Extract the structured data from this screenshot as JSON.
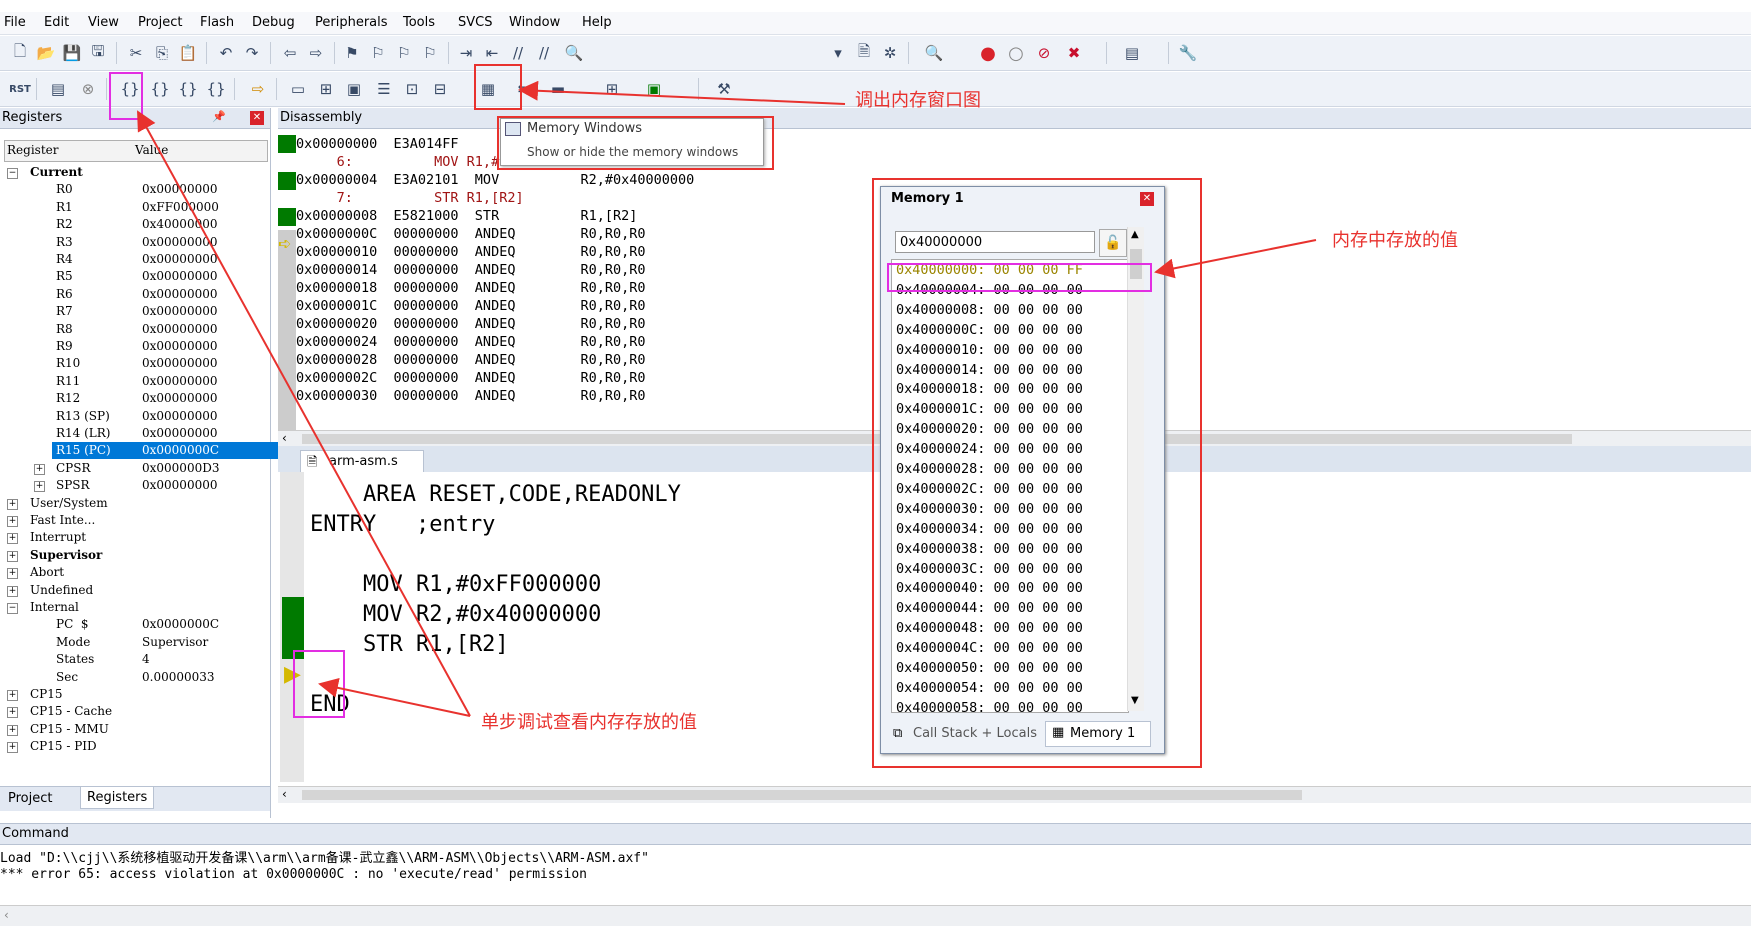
{
  "menu": [
    "File",
    "Edit",
    "View",
    "Project",
    "Flash",
    "Debug",
    "Peripherals",
    "Tools",
    "SVCS",
    "Window",
    "Help"
  ],
  "registers": {
    "title": "Registers",
    "columns": [
      "Register",
      "Value"
    ],
    "rows": [
      {
        "name": "Current",
        "value": "",
        "indent": 0,
        "expand": "−",
        "bold": true
      },
      {
        "name": "R0",
        "value": "0x00000000",
        "indent": 2
      },
      {
        "name": "R1",
        "value": "0xFF000000",
        "indent": 2
      },
      {
        "name": "R2",
        "value": "0x40000000",
        "indent": 2
      },
      {
        "name": "R3",
        "value": "0x00000000",
        "indent": 2
      },
      {
        "name": "R4",
        "value": "0x00000000",
        "indent": 2
      },
      {
        "name": "R5",
        "value": "0x00000000",
        "indent": 2
      },
      {
        "name": "R6",
        "value": "0x00000000",
        "indent": 2
      },
      {
        "name": "R7",
        "value": "0x00000000",
        "indent": 2
      },
      {
        "name": "R8",
        "value": "0x00000000",
        "indent": 2
      },
      {
        "name": "R9",
        "value": "0x00000000",
        "indent": 2
      },
      {
        "name": "R10",
        "value": "0x00000000",
        "indent": 2
      },
      {
        "name": "R11",
        "value": "0x00000000",
        "indent": 2
      },
      {
        "name": "R12",
        "value": "0x00000000",
        "indent": 2
      },
      {
        "name": "R13 (SP)",
        "value": "0x00000000",
        "indent": 2
      },
      {
        "name": "R14 (LR)",
        "value": "0x00000000",
        "indent": 2
      },
      {
        "name": "R15 (PC)",
        "value": "0x0000000C",
        "indent": 2,
        "selected": true
      },
      {
        "name": "CPSR",
        "value": "0x000000D3",
        "indent": 2,
        "expand": "+"
      },
      {
        "name": "SPSR",
        "value": "0x00000000",
        "indent": 2,
        "expand": "+"
      },
      {
        "name": "User/System",
        "value": "",
        "indent": 0,
        "expand": "+"
      },
      {
        "name": "Fast Inte...",
        "value": "",
        "indent": 0,
        "expand": "+"
      },
      {
        "name": "Interrupt",
        "value": "",
        "indent": 0,
        "expand": "+"
      },
      {
        "name": "Supervisor",
        "value": "",
        "indent": 0,
        "expand": "+",
        "bold": true
      },
      {
        "name": "Abort",
        "value": "",
        "indent": 0,
        "expand": "+"
      },
      {
        "name": "Undefined",
        "value": "",
        "indent": 0,
        "expand": "+"
      },
      {
        "name": "Internal",
        "value": "",
        "indent": 0,
        "expand": "−"
      },
      {
        "name": "PC  $",
        "value": "0x0000000C",
        "indent": 2
      },
      {
        "name": "Mode",
        "value": "Supervisor",
        "indent": 2
      },
      {
        "name": "States",
        "value": "4",
        "indent": 2
      },
      {
        "name": "Sec",
        "value": "0.00000033",
        "indent": 2
      },
      {
        "name": "CP15",
        "value": "",
        "indent": 0,
        "expand": "+"
      },
      {
        "name": "CP15 - Cache",
        "value": "",
        "indent": 0,
        "expand": "+"
      },
      {
        "name": "CP15 - MMU",
        "value": "",
        "indent": 0,
        "expand": "+"
      },
      {
        "name": "CP15 - PID",
        "value": "",
        "indent": 0,
        "expand": "+"
      }
    ],
    "bottom_tabs": [
      "Project",
      "Registers"
    ]
  },
  "disassembly": {
    "title": "Disassembly",
    "lines": [
      "0x00000000  E3A014FF",
      "     6:          MOV R1,#0xFF000000",
      "0x00000004  E3A02101  MOV          R2,#0x40000000",
      "     7:          STR R1,[R2]",
      "0x00000008  E5821000  STR          R1,[R2]",
      "0x0000000C  00000000  ANDEQ        R0,R0,R0",
      "0x00000010  00000000  ANDEQ        R0,R0,R0",
      "0x00000014  00000000  ANDEQ        R0,R0,R0",
      "0x00000018  00000000  ANDEQ        R0,R0,R0",
      "0x0000001C  00000000  ANDEQ        R0,R0,R0",
      "0x00000020  00000000  ANDEQ        R0,R0,R0",
      "0x00000024  00000000  ANDEQ        R0,R0,R0",
      "0x00000028  00000000  ANDEQ        R0,R0,R0",
      "0x0000002C  00000000  ANDEQ        R0,R0,R0",
      "0x00000030  00000000  ANDEQ        R0,R0,R0"
    ]
  },
  "tooltip": {
    "title": "Memory Windows",
    "desc": "Show or hide the memory windows"
  },
  "editor": {
    "tab": "arm-asm.s",
    "lines": [
      "    AREA RESET,CODE,READONLY",
      "ENTRY   ;entry",
      "",
      "    MOV R1,#0xFF000000",
      "    MOV R2,#0x40000000",
      "    STR R1,[R2]",
      "",
      "END"
    ]
  },
  "memory": {
    "title": "Memory 1",
    "address": "0x40000000",
    "rows": [
      "0x40000000: 00 00 00 FF",
      "0x40000004: 00 00 00 00",
      "0x40000008: 00 00 00 00",
      "0x4000000C: 00 00 00 00",
      "0x40000010: 00 00 00 00",
      "0x40000014: 00 00 00 00",
      "0x40000018: 00 00 00 00",
      "0x4000001C: 00 00 00 00",
      "0x40000020: 00 00 00 00",
      "0x40000024: 00 00 00 00",
      "0x40000028: 00 00 00 00",
      "0x4000002C: 00 00 00 00",
      "0x40000030: 00 00 00 00",
      "0x40000034: 00 00 00 00",
      "0x40000038: 00 00 00 00",
      "0x4000003C: 00 00 00 00",
      "0x40000040: 00 00 00 00",
      "0x40000044: 00 00 00 00",
      "0x40000048: 00 00 00 00",
      "0x4000004C: 00 00 00 00",
      "0x40000050: 00 00 00 00",
      "0x40000054: 00 00 00 00",
      "0x40000058: 00 00 00 00"
    ],
    "tabs": [
      "Call Stack + Locals",
      "Memory 1"
    ]
  },
  "annotations": {
    "memory_window": "调出内存窗口图",
    "memory_value": "内存中存放的值",
    "step_debug": "单步调试查看内存存放的值"
  },
  "command": {
    "title": "Command",
    "lines": [
      "Load \"D:\\\\cjj\\\\系统移植驱动开发备课\\\\arm\\\\arm备课-武立鑫\\\\ARM-ASM\\\\Objects\\\\ARM-ASM.axf\"",
      "*** error 65: access violation at 0x0000000C : no 'execute/read' permission"
    ]
  },
  "colors": {
    "annotation_red": "#e8322e",
    "highlight_magenta": "#e22ee2",
    "pc_selection": "#0078d7",
    "breakpoint_green": "#007a00",
    "changed_memory": "#b09a00"
  }
}
